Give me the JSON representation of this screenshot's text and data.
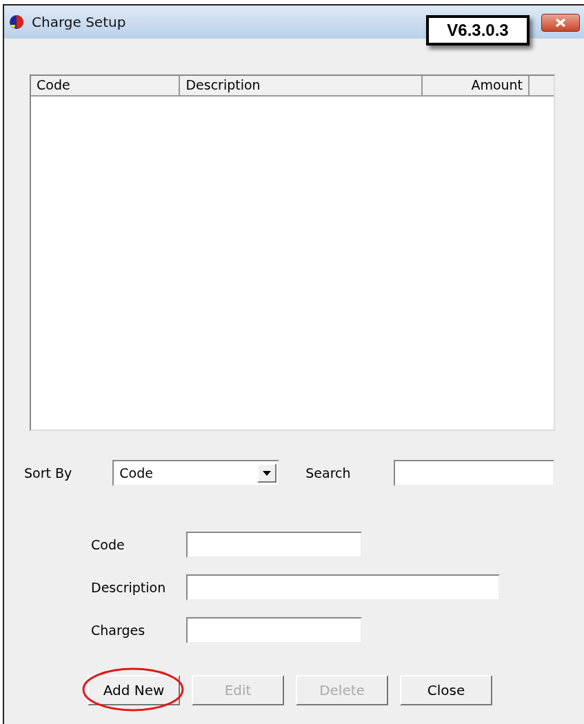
{
  "window": {
    "title": "Charge Setup"
  },
  "version_badge": "V6.3.0.3",
  "table": {
    "columns": [
      {
        "label": "Code"
      },
      {
        "label": "Description"
      },
      {
        "label": "Amount"
      }
    ]
  },
  "sort_by": {
    "label": "Sort By",
    "value": "Code"
  },
  "search": {
    "label": "Search"
  },
  "fields": [
    {
      "label": "Code"
    },
    {
      "label": "Description"
    },
    {
      "label": "Charges"
    }
  ],
  "buttons": [
    {
      "label": "Add New",
      "disabled": false,
      "highlighted": true
    },
    {
      "label": "Edit",
      "disabled": true,
      "highlighted": false
    },
    {
      "label": "Delete",
      "disabled": true,
      "highlighted": false
    },
    {
      "label": "Close",
      "disabled": false,
      "highlighted": false
    }
  ]
}
